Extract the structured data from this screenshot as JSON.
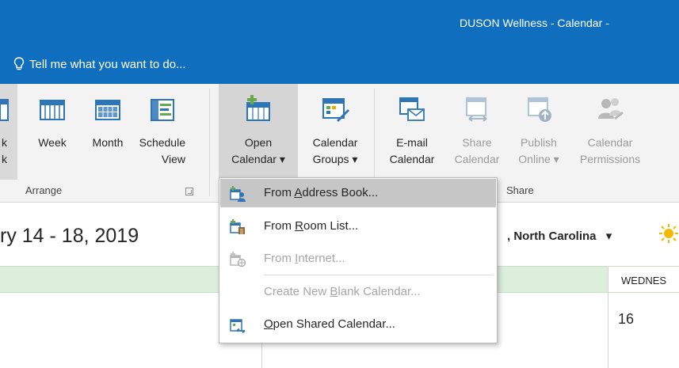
{
  "window": {
    "title": "DUSON Wellness - Calendar - "
  },
  "tell_me": {
    "text": "Tell me what you want to do..."
  },
  "ribbon": {
    "arrange_buttons": [
      {
        "name": "work-week",
        "line1": "k",
        "line2": "k"
      },
      {
        "name": "week",
        "line1": "Week",
        "line2": ""
      },
      {
        "name": "month",
        "line1": "Month",
        "line2": ""
      },
      {
        "name": "schedule-view",
        "line1": "Schedule",
        "line2": "View"
      }
    ],
    "manage_buttons": [
      {
        "name": "open-calendar",
        "line1": "Open",
        "line2": "Calendar ▾",
        "state": "pressed"
      },
      {
        "name": "calendar-groups",
        "line1": "Calendar",
        "line2": "Groups ▾"
      }
    ],
    "share_buttons": [
      {
        "name": "email-calendar",
        "line1": "E-mail",
        "line2": "Calendar",
        "enabled": true
      },
      {
        "name": "share-calendar",
        "line1": "Share",
        "line2": "Calendar",
        "enabled": false
      },
      {
        "name": "publish-online",
        "line1": "Publish",
        "line2": "Online ▾",
        "enabled": false
      },
      {
        "name": "calendar-permissions",
        "line1": "Calendar",
        "line2": "Permissions",
        "enabled": false
      }
    ],
    "groups": {
      "arrange": "Arrange",
      "share": "Share"
    }
  },
  "calendar": {
    "date_range": "ry 14 - 18, 2019",
    "location": ", North Carolina",
    "location_dropdown": "▾",
    "day_header": "WEDNES",
    "day_number": "16"
  },
  "menu": {
    "items": [
      {
        "pre": "From ",
        "u": "A",
        "post": "ddress Book...",
        "enabled": true,
        "highlighted": true,
        "icon": "address-book-icon"
      },
      {
        "pre": "From ",
        "u": "R",
        "post": "oom List...",
        "enabled": true,
        "highlighted": false,
        "icon": "room-list-icon"
      },
      {
        "pre": "From ",
        "u": "I",
        "post": "nternet...",
        "enabled": false,
        "highlighted": false,
        "icon": "internet-calendar-icon"
      },
      {
        "pre": "Create New ",
        "u": "B",
        "post": "lank Calendar...",
        "enabled": false,
        "highlighted": false,
        "icon": ""
      },
      {
        "pre": "",
        "u": "O",
        "post": "pen Shared Calendar...",
        "enabled": true,
        "highlighted": false,
        "icon": "shared-calendar-icon"
      }
    ]
  },
  "colors": {
    "titlebar": "#106ebe",
    "ribbon": "#f3f3f3",
    "menu_highlight": "#c6c6c6",
    "day_header_bg": "#dcefdc",
    "calendar_icon_blue": "#2e75b6",
    "icon_green": "#6aa84f",
    "sun": "#f5b800"
  }
}
